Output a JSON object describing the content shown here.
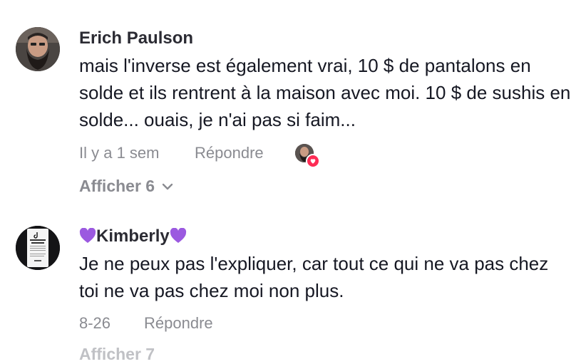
{
  "comments": [
    {
      "author": "Erich Paulson",
      "text": "mais l'inverse est également vrai, 10 $ de pantalons en solde et ils rentrent à la maison avec moi. 10 $ de sushis en solde... ouais, je n'ai pas si faim...",
      "time": "Il y a 1 sem",
      "reply_label": "Répondre",
      "show_replies": "Afficher 6",
      "liked_by_creator": true
    },
    {
      "author": "Kimberly",
      "author_decoration": "purple-heart",
      "text": "Je ne peux pas l'expliquer, car tout ce qui ne va pas chez toi ne va pas chez moi non plus.",
      "time": "8-26",
      "reply_label": "Répondre",
      "show_replies_partial": "Afficher 7"
    }
  ],
  "colors": {
    "accent_heart": "#fe2c55",
    "purple_heart": "#9b59e0",
    "meta_gray": "#8a8b91"
  }
}
